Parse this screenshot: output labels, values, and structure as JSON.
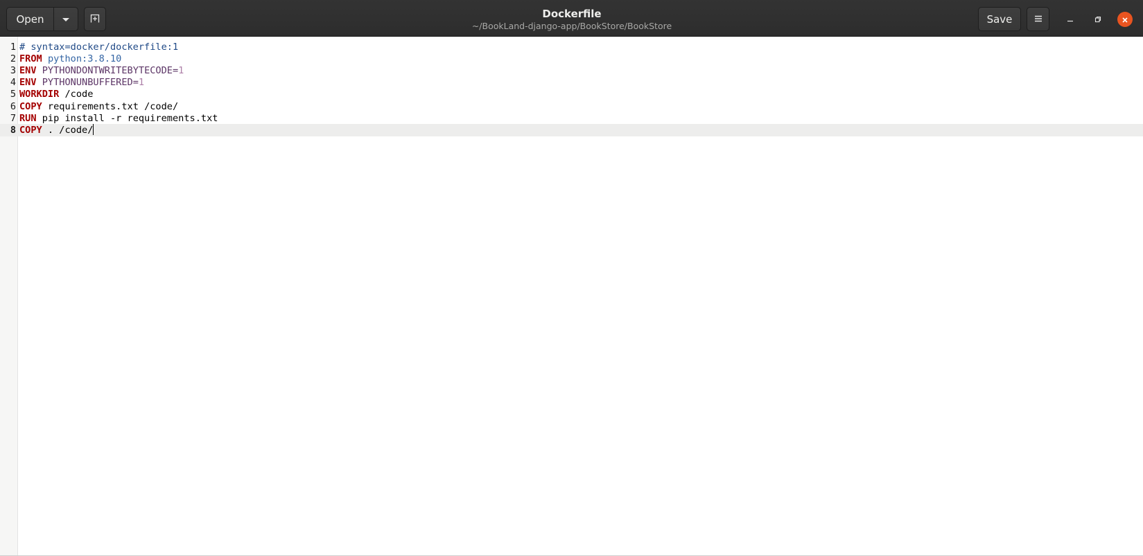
{
  "header": {
    "open_label": "Open",
    "save_label": "Save",
    "title": "Dockerfile",
    "subtitle": "~/BookLand-django-app/BookStore/BookStore"
  },
  "icons": {
    "open_menu": "chevron-down-icon",
    "new_tab": "new-document-icon",
    "menu": "hamburger-menu-icon",
    "minimize": "minimize-icon",
    "maximize": "maximize-icon",
    "close": "close-icon"
  },
  "colors": {
    "close_button": "#e95420",
    "keyword": "#a40000",
    "comment": "#204a87",
    "image": "#3465a4",
    "variable": "#5c3566",
    "number": "#ad7fa8",
    "current_line": "#ededec"
  },
  "editor": {
    "current_line": 8,
    "lines": [
      {
        "number": "1",
        "tokens": [
          {
            "t": "# syntax=docker/dockerfile:1",
            "k": "comment"
          }
        ]
      },
      {
        "number": "2",
        "tokens": [
          {
            "t": "FROM",
            "k": "keyword"
          },
          {
            "t": " ",
            "k": "plain"
          },
          {
            "t": "python:3.8.10",
            "k": "image"
          }
        ]
      },
      {
        "number": "3",
        "tokens": [
          {
            "t": "ENV",
            "k": "keyword"
          },
          {
            "t": " ",
            "k": "plain"
          },
          {
            "t": "PYTHONDONTWRITEBYTECODE=",
            "k": "var"
          },
          {
            "t": "1",
            "k": "num"
          }
        ]
      },
      {
        "number": "4",
        "tokens": [
          {
            "t": "ENV",
            "k": "keyword"
          },
          {
            "t": " ",
            "k": "plain"
          },
          {
            "t": "PYTHONUNBUFFERED=",
            "k": "var"
          },
          {
            "t": "1",
            "k": "num"
          }
        ]
      },
      {
        "number": "5",
        "tokens": [
          {
            "t": "WORKDIR",
            "k": "keyword"
          },
          {
            "t": " /code",
            "k": "plain"
          }
        ]
      },
      {
        "number": "6",
        "tokens": [
          {
            "t": "COPY",
            "k": "keyword"
          },
          {
            "t": " requirements.txt /code/",
            "k": "plain"
          }
        ]
      },
      {
        "number": "7",
        "tokens": [
          {
            "t": "RUN",
            "k": "keyword"
          },
          {
            "t": " pip install -r requirements.txt",
            "k": "plain"
          }
        ]
      },
      {
        "number": "8",
        "tokens": [
          {
            "t": "COPY",
            "k": "keyword"
          },
          {
            "t": " . /code/",
            "k": "plain"
          }
        ]
      }
    ]
  }
}
